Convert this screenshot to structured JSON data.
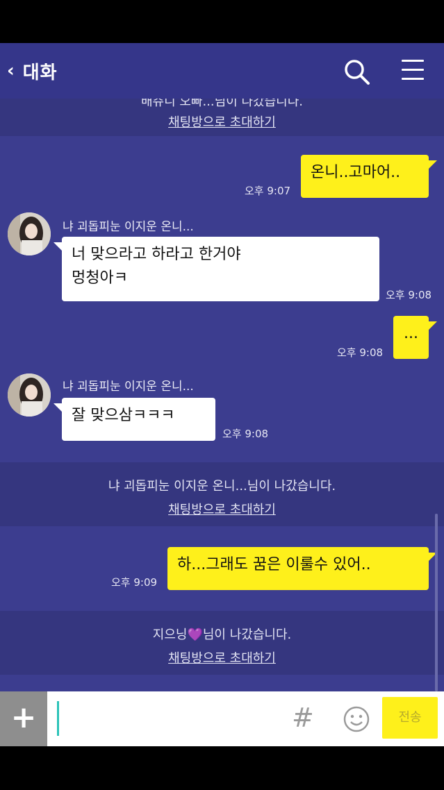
{
  "header": {
    "back_label": "대화",
    "back_icon": "chevron-left-icon",
    "search_icon": "search-icon",
    "menu_icon": "menu-icon"
  },
  "system_notices": [
    {
      "text": "배쥬니 오빠...님이 나갔습니다.",
      "link": "채팅방으로 초대하기"
    },
    {
      "text": "냐 괴돕피눈 이지운 온니...님이 나갔습니다.",
      "link": "채팅방으로 초대하기"
    },
    {
      "text": "지으닝💜님이 나갔습니다.",
      "link": "채팅방으로 초대하기"
    }
  ],
  "messages": [
    {
      "side": "right",
      "text": "온니..고마어..",
      "time": "오후 9:07"
    },
    {
      "side": "left",
      "sender": "냐 괴돕피눈 이지운 온니...",
      "lines": [
        "너 맞으라고 하라고 한거야",
        "멍청아ㅋ"
      ],
      "time": "오후 9:08"
    },
    {
      "side": "right",
      "text": "...",
      "time": "오후 9:08"
    },
    {
      "side": "left",
      "sender": "냐 괴돕피눈 이지운 온니...",
      "text": "잘 맞으삼ㅋㅋㅋ",
      "time": "오후 9:08"
    },
    {
      "side": "right",
      "text": "하...그래도 꿈은 이룰수 있어..",
      "time": "오후 9:09"
    }
  ],
  "input_bar": {
    "plus_label": "+",
    "hash_label": "#",
    "emoji_icon": "smiley-icon",
    "send_label": "전송",
    "input_value": ""
  },
  "colors": {
    "background": "#3c3d8f",
    "header": "#35368a",
    "system_band": "#35367f",
    "my_bubble": "#fef01b",
    "other_bubble": "#ffffff",
    "caret": "#2bc3b8"
  }
}
